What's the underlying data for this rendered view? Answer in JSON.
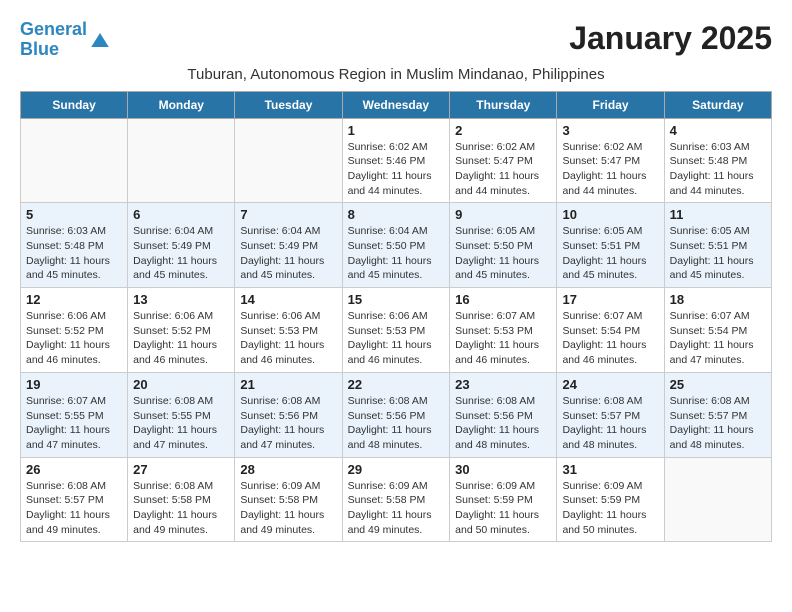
{
  "logo": {
    "line1": "General",
    "line2": "Blue"
  },
  "title": "January 2025",
  "subtitle": "Tuburan, Autonomous Region in Muslim Mindanao, Philippines",
  "weekdays": [
    "Sunday",
    "Monday",
    "Tuesday",
    "Wednesday",
    "Thursday",
    "Friday",
    "Saturday"
  ],
  "weeks": [
    [
      {
        "day": "",
        "info": ""
      },
      {
        "day": "",
        "info": ""
      },
      {
        "day": "",
        "info": ""
      },
      {
        "day": "1",
        "info": "Sunrise: 6:02 AM\nSunset: 5:46 PM\nDaylight: 11 hours\nand 44 minutes."
      },
      {
        "day": "2",
        "info": "Sunrise: 6:02 AM\nSunset: 5:47 PM\nDaylight: 11 hours\nand 44 minutes."
      },
      {
        "day": "3",
        "info": "Sunrise: 6:02 AM\nSunset: 5:47 PM\nDaylight: 11 hours\nand 44 minutes."
      },
      {
        "day": "4",
        "info": "Sunrise: 6:03 AM\nSunset: 5:48 PM\nDaylight: 11 hours\nand 44 minutes."
      }
    ],
    [
      {
        "day": "5",
        "info": "Sunrise: 6:03 AM\nSunset: 5:48 PM\nDaylight: 11 hours\nand 45 minutes."
      },
      {
        "day": "6",
        "info": "Sunrise: 6:04 AM\nSunset: 5:49 PM\nDaylight: 11 hours\nand 45 minutes."
      },
      {
        "day": "7",
        "info": "Sunrise: 6:04 AM\nSunset: 5:49 PM\nDaylight: 11 hours\nand 45 minutes."
      },
      {
        "day": "8",
        "info": "Sunrise: 6:04 AM\nSunset: 5:50 PM\nDaylight: 11 hours\nand 45 minutes."
      },
      {
        "day": "9",
        "info": "Sunrise: 6:05 AM\nSunset: 5:50 PM\nDaylight: 11 hours\nand 45 minutes."
      },
      {
        "day": "10",
        "info": "Sunrise: 6:05 AM\nSunset: 5:51 PM\nDaylight: 11 hours\nand 45 minutes."
      },
      {
        "day": "11",
        "info": "Sunrise: 6:05 AM\nSunset: 5:51 PM\nDaylight: 11 hours\nand 45 minutes."
      }
    ],
    [
      {
        "day": "12",
        "info": "Sunrise: 6:06 AM\nSunset: 5:52 PM\nDaylight: 11 hours\nand 46 minutes."
      },
      {
        "day": "13",
        "info": "Sunrise: 6:06 AM\nSunset: 5:52 PM\nDaylight: 11 hours\nand 46 minutes."
      },
      {
        "day": "14",
        "info": "Sunrise: 6:06 AM\nSunset: 5:53 PM\nDaylight: 11 hours\nand 46 minutes."
      },
      {
        "day": "15",
        "info": "Sunrise: 6:06 AM\nSunset: 5:53 PM\nDaylight: 11 hours\nand 46 minutes."
      },
      {
        "day": "16",
        "info": "Sunrise: 6:07 AM\nSunset: 5:53 PM\nDaylight: 11 hours\nand 46 minutes."
      },
      {
        "day": "17",
        "info": "Sunrise: 6:07 AM\nSunset: 5:54 PM\nDaylight: 11 hours\nand 46 minutes."
      },
      {
        "day": "18",
        "info": "Sunrise: 6:07 AM\nSunset: 5:54 PM\nDaylight: 11 hours\nand 47 minutes."
      }
    ],
    [
      {
        "day": "19",
        "info": "Sunrise: 6:07 AM\nSunset: 5:55 PM\nDaylight: 11 hours\nand 47 minutes."
      },
      {
        "day": "20",
        "info": "Sunrise: 6:08 AM\nSunset: 5:55 PM\nDaylight: 11 hours\nand 47 minutes."
      },
      {
        "day": "21",
        "info": "Sunrise: 6:08 AM\nSunset: 5:56 PM\nDaylight: 11 hours\nand 47 minutes."
      },
      {
        "day": "22",
        "info": "Sunrise: 6:08 AM\nSunset: 5:56 PM\nDaylight: 11 hours\nand 48 minutes."
      },
      {
        "day": "23",
        "info": "Sunrise: 6:08 AM\nSunset: 5:56 PM\nDaylight: 11 hours\nand 48 minutes."
      },
      {
        "day": "24",
        "info": "Sunrise: 6:08 AM\nSunset: 5:57 PM\nDaylight: 11 hours\nand 48 minutes."
      },
      {
        "day": "25",
        "info": "Sunrise: 6:08 AM\nSunset: 5:57 PM\nDaylight: 11 hours\nand 48 minutes."
      }
    ],
    [
      {
        "day": "26",
        "info": "Sunrise: 6:08 AM\nSunset: 5:57 PM\nDaylight: 11 hours\nand 49 minutes."
      },
      {
        "day": "27",
        "info": "Sunrise: 6:08 AM\nSunset: 5:58 PM\nDaylight: 11 hours\nand 49 minutes."
      },
      {
        "day": "28",
        "info": "Sunrise: 6:09 AM\nSunset: 5:58 PM\nDaylight: 11 hours\nand 49 minutes."
      },
      {
        "day": "29",
        "info": "Sunrise: 6:09 AM\nSunset: 5:58 PM\nDaylight: 11 hours\nand 49 minutes."
      },
      {
        "day": "30",
        "info": "Sunrise: 6:09 AM\nSunset: 5:59 PM\nDaylight: 11 hours\nand 50 minutes."
      },
      {
        "day": "31",
        "info": "Sunrise: 6:09 AM\nSunset: 5:59 PM\nDaylight: 11 hours\nand 50 minutes."
      },
      {
        "day": "",
        "info": ""
      }
    ]
  ]
}
